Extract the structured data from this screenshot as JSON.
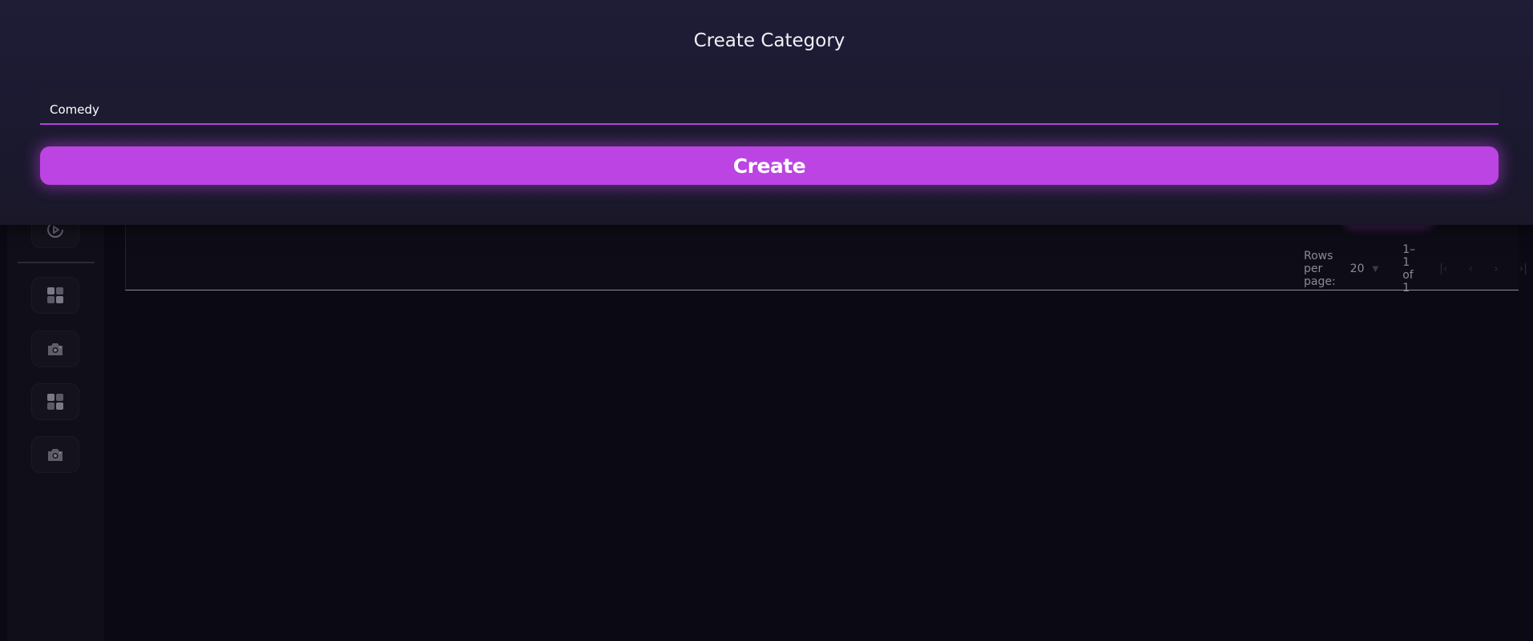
{
  "sidebar": {
    "items": [
      {
        "icon": "play-circle-icon"
      },
      {
        "icon": "grid-icon"
      },
      {
        "icon": "camera-icon"
      },
      {
        "icon": "grid-icon"
      },
      {
        "icon": "camera-icon"
      }
    ]
  },
  "table": {
    "pagination": {
      "rows_per_page_label": "Rows per page:",
      "rows_per_page_value": "20",
      "range_text": "1–1 of 1"
    }
  },
  "modal": {
    "title": "Create Category",
    "name_input_value": "Comedy",
    "create_label": "Create"
  },
  "colors": {
    "accent": "#bb44e2",
    "modal_bg": "#1f1c36",
    "page_bg": "#0b0a14"
  }
}
